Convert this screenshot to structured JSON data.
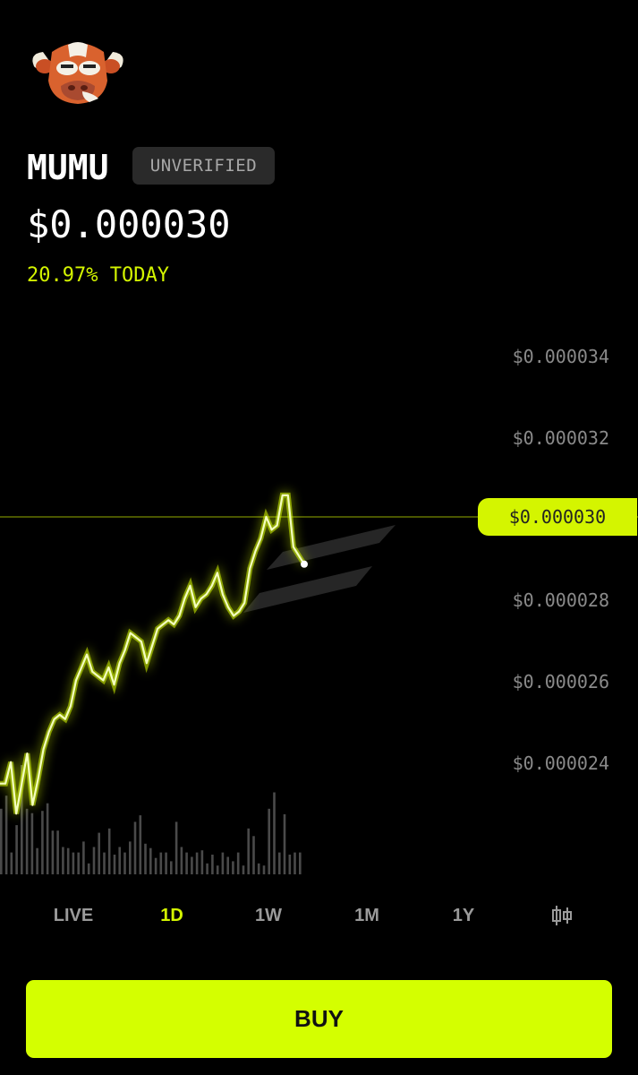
{
  "token": {
    "logo_icon": "bull-face-logo-icon",
    "name": "MUMU",
    "badge": "UNVERIFIED",
    "price": "$0.000030",
    "change": "20.97% TODAY"
  },
  "colors": {
    "accent": "#d4f500",
    "background": "#000000",
    "badge_bg": "#2a2a2a",
    "axis_text": "#8a8a8a"
  },
  "chart_data": {
    "type": "line",
    "y_tick_labels": [
      "$0.000034",
      "$0.000032",
      "$0.000028",
      "$0.000026",
      "$0.000024"
    ],
    "current_value_label": "$0.000030",
    "current_value": 3e-05,
    "ylim": [
      2.25e-05,
      3.52e-05
    ],
    "watermark_icon": "solana-logo-icon",
    "series": [
      {
        "values": [
          2.49e-05,
          2.49e-05,
          2.54e-05,
          2.42e-05,
          2.49e-05,
          2.56e-05,
          2.44e-05,
          2.5e-05,
          2.57e-05,
          2.61e-05,
          2.64e-05,
          2.65e-05,
          2.64e-05,
          2.67e-05,
          2.73e-05,
          2.76e-05,
          2.79e-05,
          2.75e-05,
          2.74e-05,
          2.73e-05,
          2.76e-05,
          2.72e-05,
          2.77e-05,
          2.8e-05,
          2.84e-05,
          2.83e-05,
          2.82e-05,
          2.77e-05,
          2.81e-05,
          2.85e-05,
          2.86e-05,
          2.87e-05,
          2.86e-05,
          2.88e-05,
          2.92e-05,
          2.95e-05,
          2.9e-05,
          2.92e-05,
          2.93e-05,
          2.95e-05,
          2.98e-05,
          2.93e-05,
          2.9e-05,
          2.88e-05,
          2.89e-05,
          2.91e-05,
          2.99e-05,
          3.03e-05,
          3.06e-05,
          3.11e-05,
          3.08e-05,
          3.09e-05,
          3.16e-05,
          3.16e-05,
          3.04e-05,
          3.02e-05,
          3e-05
        ]
      }
    ],
    "volume": [
      60,
      72,
      20,
      45,
      100,
      60,
      56,
      24,
      58,
      65,
      40,
      40,
      25,
      24,
      20,
      20,
      30,
      10,
      25,
      38,
      20,
      42,
      18,
      25,
      20,
      30,
      48,
      54,
      28,
      24,
      15,
      20,
      20,
      12,
      48,
      25,
      20,
      16,
      20,
      22,
      10,
      18,
      8,
      20,
      16,
      12,
      20,
      8,
      42,
      35,
      10,
      8,
      60,
      75,
      20,
      55,
      18,
      20,
      20
    ]
  },
  "timeframes": [
    "LIVE",
    "1D",
    "1W",
    "1M",
    "1Y"
  ],
  "active_timeframe": "1D",
  "candle_toggle_icon": "candlestick-icon",
  "buy_label": "BUY"
}
